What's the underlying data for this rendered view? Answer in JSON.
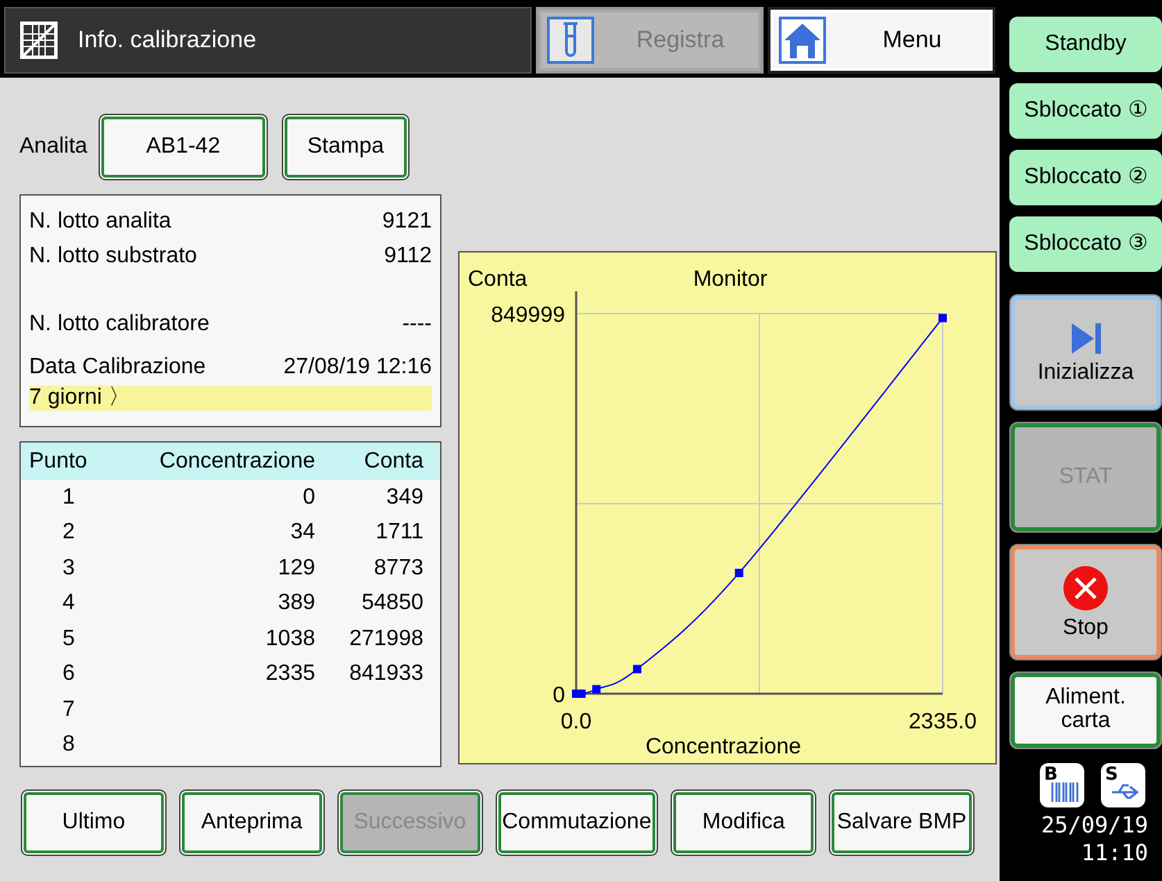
{
  "header": {
    "title": "Info. calibrazione",
    "buttons": [
      {
        "kind": "record",
        "label": "Registra",
        "disabled": true
      },
      {
        "kind": "home",
        "label": "Menu",
        "disabled": false
      }
    ]
  },
  "analyte": {
    "label": "Analita",
    "value": "AB1-42",
    "print": "Stampa"
  },
  "info": {
    "rows": [
      {
        "label": "N. lotto analita",
        "value": "9121"
      },
      {
        "label": "N. lotto substrato",
        "value": "9112"
      },
      {
        "label": "N. lotto calibratore",
        "value": "----"
      },
      {
        "label": "Data Calibrazione",
        "value": "27/08/19 12:16"
      }
    ],
    "note": "7 giorni 〉"
  },
  "table": {
    "columns": [
      "Punto",
      "Concentrazione",
      "Conta"
    ],
    "rows": [
      [
        "1",
        "0",
        "349"
      ],
      [
        "2",
        "34",
        "1711"
      ],
      [
        "3",
        "129",
        "8773"
      ],
      [
        "4",
        "389",
        "54850"
      ],
      [
        "5",
        "1038",
        "271998"
      ],
      [
        "6",
        "2335",
        "841933"
      ],
      [
        "7"
      ],
      [
        "8"
      ]
    ]
  },
  "chart_data": {
    "type": "line",
    "title": "Monitor",
    "xlabel": "Concentrazione",
    "ylabel": "Conta",
    "x": [
      0,
      34,
      129,
      389,
      1038,
      2335
    ],
    "series": [
      {
        "color": "#0000ff",
        "marker": "square",
        "values": [
          0,
          0,
          10000,
          55000,
          270000,
          840000
        ]
      }
    ],
    "ref_lines": [
      {
        "axis": "x",
        "value": 1167.5
      },
      {
        "axis": "y",
        "value": 425000
      }
    ],
    "xlim": [
      0,
      2335
    ],
    "ylim": [
      0,
      849999
    ],
    "xticks": [
      {
        "value": 0,
        "label": "0.0"
      },
      {
        "value": 2335,
        "label": "2335.0"
      }
    ],
    "yticks": [
      {
        "value": 0,
        "label": "0"
      },
      {
        "value": 849999,
        "label": "849999"
      }
    ]
  },
  "footer_buttons": [
    {
      "label": "Ultimo",
      "disabled": false
    },
    {
      "label": "Anteprima",
      "disabled": false
    },
    {
      "label": "Successivo",
      "disabled": true
    },
    {
      "label": "Commutazione",
      "disabled": false
    },
    {
      "label": "Modifica",
      "disabled": false
    },
    {
      "label": "Salvare BMP",
      "disabled": false
    }
  ],
  "sidebar": {
    "buttons": [
      {
        "kind": "mode",
        "label": "Standby",
        "disabled": false
      },
      {
        "kind": "mode",
        "label": "Sbloccato ①",
        "disabled": false
      },
      {
        "kind": "mode",
        "label": "Sbloccato ②",
        "disabled": false
      },
      {
        "kind": "mode",
        "label": "Sbloccato ③",
        "disabled": false
      },
      {
        "kind": "start",
        "label": "Inizializza",
        "disabled": false
      },
      {
        "kind": "command",
        "label": "STAT",
        "disabled": true
      },
      {
        "kind": "stop",
        "label": "Stop",
        "disabled": false
      },
      {
        "kind": "command",
        "label": "Aliment. carta",
        "disabled": false
      }
    ],
    "status_icons": [
      {
        "kind": "barcode",
        "label": "B"
      },
      {
        "kind": "usb",
        "label": "S"
      }
    ],
    "date": "25/09/19",
    "time": "11:10"
  }
}
